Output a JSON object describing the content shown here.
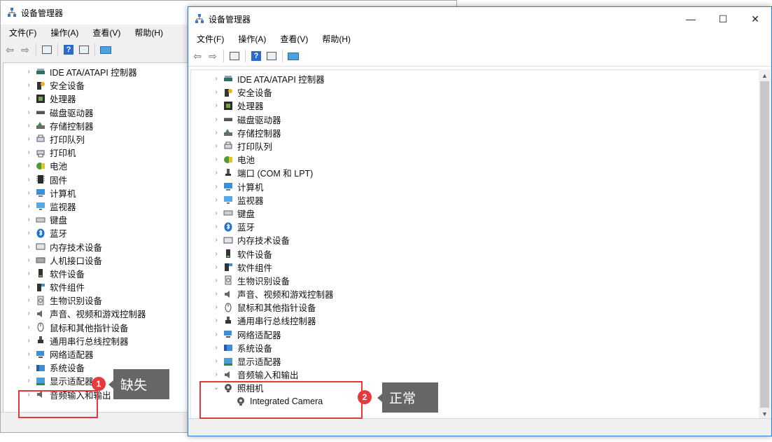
{
  "back_window": {
    "title": "设备管理器",
    "menu": [
      "文件(F)",
      "操作(A)",
      "查看(V)",
      "帮助(H)"
    ],
    "tree": [
      {
        "label": "IDE ATA/ATAPI 控制器",
        "icon": "ide-icon"
      },
      {
        "label": "安全设备",
        "icon": "security-device-icon"
      },
      {
        "label": "处理器",
        "icon": "processor-icon"
      },
      {
        "label": "磁盘驱动器",
        "icon": "disk-drive-icon"
      },
      {
        "label": "存储控制器",
        "icon": "storage-controller-icon"
      },
      {
        "label": "打印队列",
        "icon": "print-queue-icon"
      },
      {
        "label": "打印机",
        "icon": "printer-icon"
      },
      {
        "label": "电池",
        "icon": "battery-icon"
      },
      {
        "label": "固件",
        "icon": "firmware-icon"
      },
      {
        "label": "计算机",
        "icon": "computer-icon"
      },
      {
        "label": "监视器",
        "icon": "monitor-icon"
      },
      {
        "label": "键盘",
        "icon": "keyboard-icon"
      },
      {
        "label": "蓝牙",
        "icon": "bluetooth-icon"
      },
      {
        "label": "内存技术设备",
        "icon": "memory-device-icon"
      },
      {
        "label": "人机接口设备",
        "icon": "hid-icon"
      },
      {
        "label": "软件设备",
        "icon": "software-device-icon"
      },
      {
        "label": "软件组件",
        "icon": "software-component-icon"
      },
      {
        "label": "生物识别设备",
        "icon": "biometric-icon"
      },
      {
        "label": "声音、视频和游戏控制器",
        "icon": "sound-icon"
      },
      {
        "label": "鼠标和其他指针设备",
        "icon": "mouse-icon"
      },
      {
        "label": "通用串行总线控制器",
        "icon": "usb-icon"
      },
      {
        "label": "网络适配器",
        "icon": "network-adapter-icon"
      },
      {
        "label": "系统设备",
        "icon": "system-device-icon"
      },
      {
        "label": "显示适配器",
        "icon": "display-adapter-icon"
      },
      {
        "label": "音频输入和输出",
        "icon": "audio-io-icon"
      }
    ]
  },
  "front_window": {
    "title": "设备管理器",
    "menu": [
      "文件(F)",
      "操作(A)",
      "查看(V)",
      "帮助(H)"
    ],
    "controls": {
      "minimize": "—",
      "maximize": "☐",
      "close": "✕"
    },
    "tree": [
      {
        "label": "IDE ATA/ATAPI 控制器",
        "icon": "ide-icon"
      },
      {
        "label": "安全设备",
        "icon": "security-device-icon"
      },
      {
        "label": "处理器",
        "icon": "processor-icon"
      },
      {
        "label": "磁盘驱动器",
        "icon": "disk-drive-icon"
      },
      {
        "label": "存储控制器",
        "icon": "storage-controller-icon"
      },
      {
        "label": "打印队列",
        "icon": "print-queue-icon"
      },
      {
        "label": "电池",
        "icon": "battery-icon"
      },
      {
        "label": "端口 (COM 和 LPT)",
        "icon": "port-icon"
      },
      {
        "label": "计算机",
        "icon": "computer-icon"
      },
      {
        "label": "监视器",
        "icon": "monitor-icon"
      },
      {
        "label": "键盘",
        "icon": "keyboard-icon"
      },
      {
        "label": "蓝牙",
        "icon": "bluetooth-icon"
      },
      {
        "label": "内存技术设备",
        "icon": "memory-device-icon"
      },
      {
        "label": "软件设备",
        "icon": "software-device-icon"
      },
      {
        "label": "软件组件",
        "icon": "software-component-icon"
      },
      {
        "label": "生物识别设备",
        "icon": "biometric-icon"
      },
      {
        "label": "声音、视频和游戏控制器",
        "icon": "sound-icon"
      },
      {
        "label": "鼠标和其他指针设备",
        "icon": "mouse-icon"
      },
      {
        "label": "通用串行总线控制器",
        "icon": "usb-icon"
      },
      {
        "label": "网络适配器",
        "icon": "network-adapter-icon"
      },
      {
        "label": "系统设备",
        "icon": "system-device-icon"
      },
      {
        "label": "显示适配器",
        "icon": "display-adapter-icon"
      },
      {
        "label": "音频输入和输出",
        "icon": "audio-io-icon"
      },
      {
        "label": "照相机",
        "icon": "camera-icon",
        "expanded": true
      },
      {
        "label": "Integrated Camera",
        "icon": "webcam-icon",
        "child": true
      }
    ]
  },
  "annotations": {
    "missing": {
      "number": "1",
      "text": "缺失"
    },
    "normal": {
      "number": "2",
      "text": "正常"
    }
  },
  "colors": {
    "highlight": "#e0393b",
    "callout_bg": "#666666",
    "accent": "#2b79d0"
  }
}
